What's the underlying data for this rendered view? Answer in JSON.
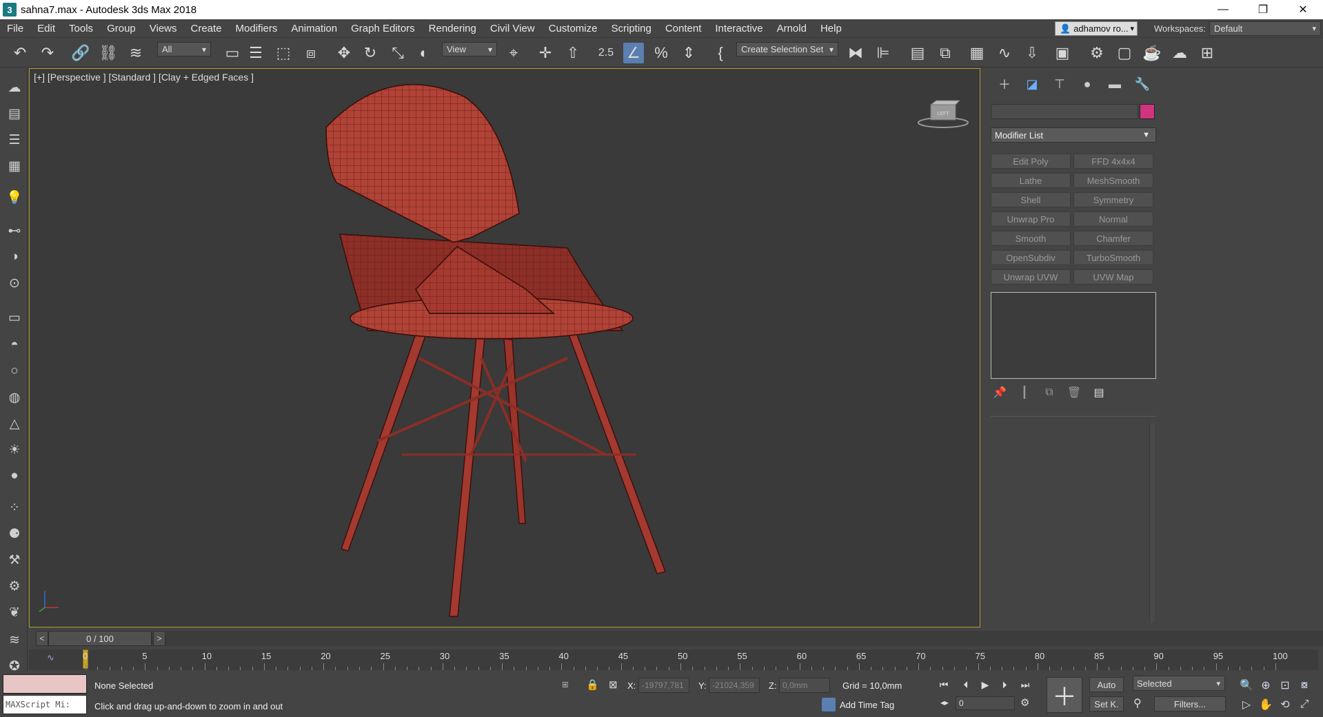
{
  "window": {
    "title": "sahna7.max - Autodesk 3ds Max 2018",
    "app_icon": "3",
    "controls": [
      "minimize-icon",
      "restore-icon",
      "close-icon"
    ]
  },
  "menu": {
    "items": [
      "File",
      "Edit",
      "Tools",
      "Group",
      "Views",
      "Create",
      "Modifiers",
      "Animation",
      "Graph Editors",
      "Rendering",
      "Civil View",
      "Customize",
      "Scripting",
      "Content",
      "Interactive",
      "Arnold",
      "Help"
    ],
    "user": "adhamov ro...",
    "workspaces_label": "Workspaces:",
    "workspace": "Default"
  },
  "toolbar": {
    "selection_filter": "All",
    "ref_coord": "View",
    "snap_label": "2.5",
    "selection_set_placeholder": "Create Selection Set"
  },
  "viewport": {
    "label": "[+] [Perspective ] [Standard ] [Clay + Edged Faces ]",
    "model_color": "#a03a30",
    "background": "#3a3a3a",
    "viewcube_label": "LEFT"
  },
  "command_panel": {
    "object_color": "#d0347f",
    "modifier_list": "Modifier List",
    "modifier_buttons": [
      "Edit Poly",
      "FFD 4x4x4",
      "Lathe",
      "MeshSmooth",
      "Shell",
      "Symmetry",
      "Unwrap Pro",
      "Normal",
      "Smooth",
      "Chamfer",
      "OpenSubdiv",
      "TurboSmooth",
      "Unwrap UVW",
      "UVW Map"
    ]
  },
  "timeline": {
    "slider_label": "0 / 100",
    "prev": "<",
    "next": ">",
    "ticks": [
      "0",
      "5",
      "10",
      "15",
      "20",
      "25",
      "30",
      "35",
      "40",
      "45",
      "50",
      "55",
      "60",
      "65",
      "70",
      "75",
      "80",
      "85",
      "90",
      "95",
      "100"
    ]
  },
  "status": {
    "maxscript": "MAXScript Mi:",
    "selection": "None Selected",
    "prompt": "Click and drag up-and-down to zoom in and out",
    "x_label": "X:",
    "x_value": "-19797,781",
    "y_label": "Y:",
    "y_value": "-21024,359",
    "z_label": "Z:",
    "z_value": "0,0mm",
    "grid": "Grid = 10,0mm",
    "add_time_tag": "Add Time Tag",
    "frame": "0",
    "auto_key": "Auto",
    "set_key": "Set K.",
    "key_filter": "Selected",
    "filters": "Filters..."
  }
}
